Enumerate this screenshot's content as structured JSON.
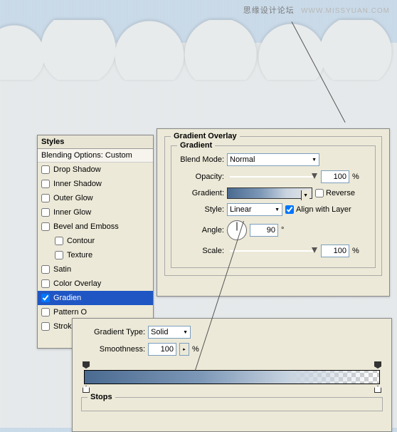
{
  "watermark": {
    "cn": "思缘设计论坛",
    "en": "WWW.MISSYUAN.COM"
  },
  "styles": {
    "header": "Styles",
    "subheader": "Blending Options: Custom",
    "items": [
      {
        "label": "Drop Shadow",
        "checked": false,
        "selected": false,
        "indent": false
      },
      {
        "label": "Inner Shadow",
        "checked": false,
        "selected": false,
        "indent": false
      },
      {
        "label": "Outer Glow",
        "checked": false,
        "selected": false,
        "indent": false
      },
      {
        "label": "Inner Glow",
        "checked": false,
        "selected": false,
        "indent": false
      },
      {
        "label": "Bevel and Emboss",
        "checked": false,
        "selected": false,
        "indent": false
      },
      {
        "label": "Contour",
        "checked": false,
        "selected": false,
        "indent": true
      },
      {
        "label": "Texture",
        "checked": false,
        "selected": false,
        "indent": true
      },
      {
        "label": "Satin",
        "checked": false,
        "selected": false,
        "indent": false
      },
      {
        "label": "Color Overlay",
        "checked": false,
        "selected": false,
        "indent": false
      },
      {
        "label": "Gradient Overlay",
        "checked": true,
        "selected": true,
        "indent": false,
        "display": "Gradien"
      },
      {
        "label": "Pattern Overlay",
        "checked": false,
        "selected": false,
        "indent": false,
        "display": "Pattern O"
      },
      {
        "label": "Stroke",
        "checked": false,
        "selected": false,
        "indent": false
      }
    ]
  },
  "overlay": {
    "title": "Gradient Overlay",
    "subtitle": "Gradient",
    "blend_mode_label": "Blend Mode:",
    "blend_mode_value": "Normal",
    "opacity_label": "Opacity:",
    "opacity_value": "100",
    "pct": "%",
    "gradient_label": "Gradient:",
    "reverse_label": "Reverse",
    "reverse_checked": false,
    "style_label": "Style:",
    "style_value": "Linear",
    "align_label": "Align with Layer",
    "align_checked": true,
    "angle_label": "Angle:",
    "angle_value": "90",
    "deg": "°",
    "scale_label": "Scale:",
    "scale_value": "100"
  },
  "editor": {
    "type_label": "Gradient Type:",
    "type_value": "Solid",
    "smooth_label": "Smoothness:",
    "smooth_value": "100",
    "pct": "%",
    "stops_label": "Stops"
  }
}
